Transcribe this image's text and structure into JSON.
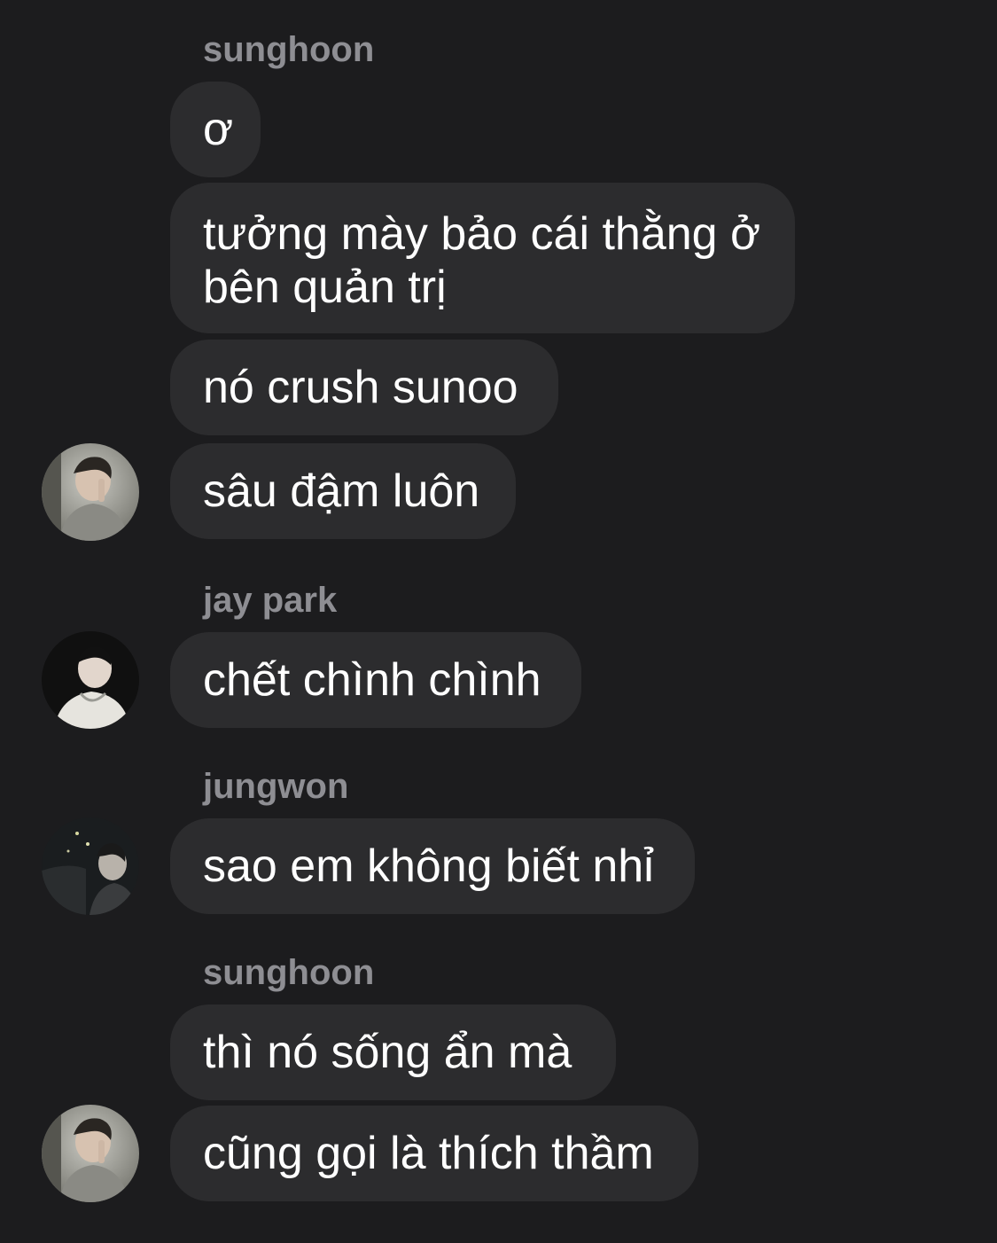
{
  "messages": {
    "group1": {
      "sender": "sunghoon",
      "m1": "ơ",
      "m2": "tưởng mày bảo cái thằng ở bên quản trị",
      "m3": "nó crush sunoo",
      "m4": "sâu đậm luôn"
    },
    "group2": {
      "sender": "jay park",
      "m1": "chết chình chình"
    },
    "group3": {
      "sender": "jungwon",
      "m1": "sao em không biết nhỉ"
    },
    "group4": {
      "sender": "sunghoon",
      "m1": "thì nó sống ẩn mà",
      "m2": "cũng gọi là thích thầm"
    }
  },
  "theme": {
    "background": "#1c1c1e",
    "bubble": "#2c2c2e",
    "sender_text": "#8e8e93",
    "message_text": "#ffffff"
  },
  "avatars": {
    "sunghoon": "sunghoon-avatar",
    "jay_park": "jay-park-avatar",
    "jungwon": "jungwon-avatar"
  }
}
